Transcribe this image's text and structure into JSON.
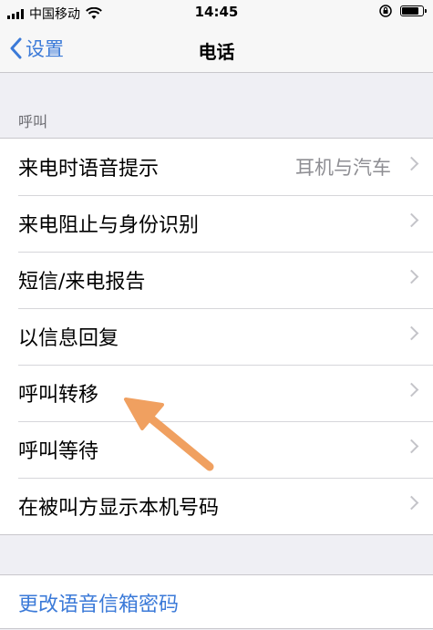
{
  "status": {
    "carrier": "中国移动",
    "time": "14:45",
    "battery_level": 0.85,
    "icons": [
      "signal-icon",
      "wifi-icon",
      "orientation-lock-icon",
      "battery-icon"
    ]
  },
  "nav": {
    "back_label": "设置",
    "title": "电话"
  },
  "section": {
    "header": "呼叫",
    "rows": [
      {
        "label": "来电时语音提示",
        "value": "耳机与汽车"
      },
      {
        "label": "来电阻止与身份识别",
        "value": ""
      },
      {
        "label": "短信/来电报告",
        "value": ""
      },
      {
        "label": "以信息回复",
        "value": ""
      },
      {
        "label": "呼叫转移",
        "value": ""
      },
      {
        "label": "呼叫等待",
        "value": ""
      },
      {
        "label": "在被叫方显示本机号码",
        "value": ""
      }
    ]
  },
  "voicemail": {
    "link_label": "更改语音信箱密码"
  },
  "colors": {
    "accent": "#3b7ad8",
    "annotation_arrow": "#f0a060",
    "background": "#efeff4"
  }
}
